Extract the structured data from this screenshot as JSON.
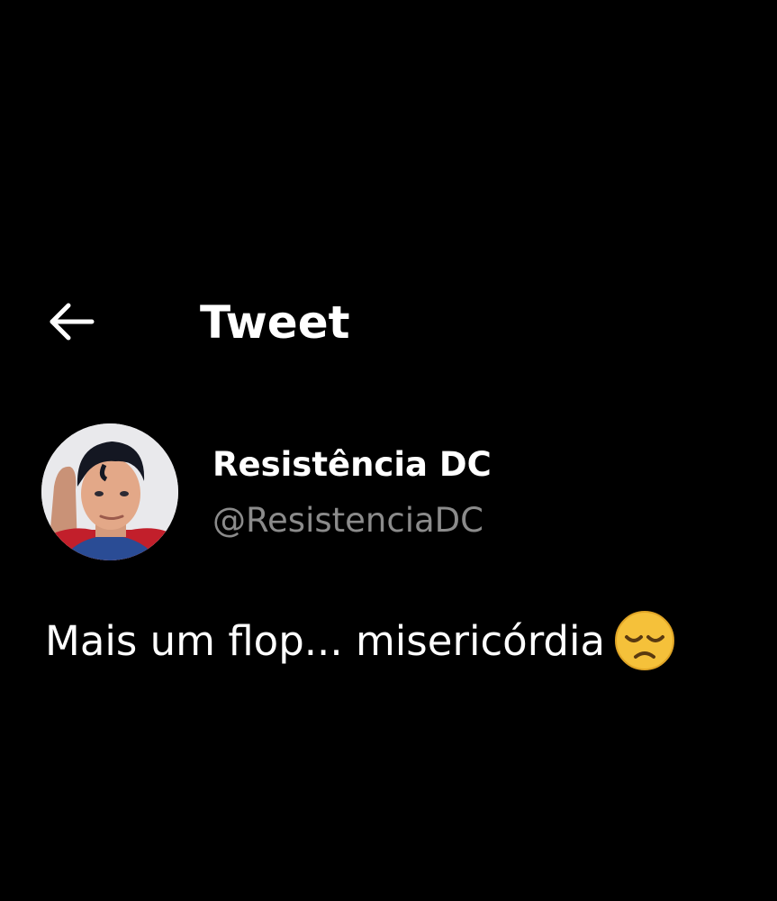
{
  "header": {
    "back_icon": "arrow-left-icon",
    "title": "Tweet"
  },
  "tweet": {
    "author": {
      "display_name": "Resistência DC",
      "handle": "@ResistenciaDC",
      "avatar": "avatar-photo"
    },
    "text": "Mais um flop... misericórdia",
    "emoji": "disappointed-face-emoji"
  },
  "colors": {
    "background": "#000000",
    "primary_text": "#ffffff",
    "secondary_text": "#8b8b8b",
    "emoji_face": "#f5c13a"
  }
}
